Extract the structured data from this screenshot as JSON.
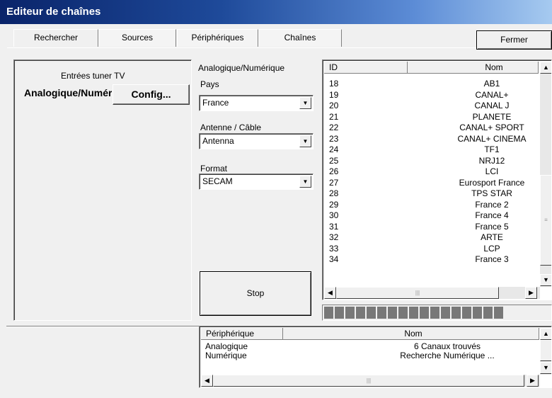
{
  "window": {
    "title": "Editeur de chaînes"
  },
  "tabs": [
    {
      "label": "Rechercher"
    },
    {
      "label": "Sources"
    },
    {
      "label": "Périphériques"
    },
    {
      "label": "Chaînes"
    }
  ],
  "close_label": "Fermer",
  "tuner": {
    "title": "Entrées tuner TV",
    "label": "Analogique/Numérique",
    "config_label": "Config..."
  },
  "form": {
    "mode_label": "Analogique/Numérique",
    "country_label": "Pays",
    "country_value": "France",
    "antenna_label": "Antenne / Câble",
    "antenna_value": "Antenna",
    "format_label": "Format",
    "format_value": "SECAM",
    "stop_label": "Stop"
  },
  "channels": {
    "columns": [
      "ID",
      "Nom"
    ],
    "rows": [
      {
        "id": "18",
        "name": "AB1"
      },
      {
        "id": "19",
        "name": "CANAL+"
      },
      {
        "id": "20",
        "name": "CANAL J"
      },
      {
        "id": "21",
        "name": "PLANETE"
      },
      {
        "id": "22",
        "name": "CANAL+ SPORT"
      },
      {
        "id": "23",
        "name": "CANAL+ CINEMA"
      },
      {
        "id": "24",
        "name": "TF1"
      },
      {
        "id": "25",
        "name": "NRJ12"
      },
      {
        "id": "26",
        "name": "LCI"
      },
      {
        "id": "27",
        "name": "Eurosport France"
      },
      {
        "id": "28",
        "name": "TPS STAR"
      },
      {
        "id": "29",
        "name": "France 2"
      },
      {
        "id": "30",
        "name": "France 4"
      },
      {
        "id": "31",
        "name": "France 5"
      },
      {
        "id": "32",
        "name": "ARTE"
      },
      {
        "id": "33",
        "name": "LCP"
      },
      {
        "id": "34",
        "name": "France 3"
      }
    ]
  },
  "progress": {
    "segments_filled": 17
  },
  "devices": {
    "columns": [
      "Périphérique",
      "Nom"
    ],
    "rows": [
      {
        "device": "Analogique",
        "name": "6 Canaux trouvés"
      },
      {
        "device": "Numérique",
        "name": "Recherche Numérique ..."
      }
    ]
  },
  "icons": {
    "scroll_up": "scroll-up-icon",
    "scroll_down": "scroll-down-icon",
    "scroll_left": "scroll-left-icon",
    "scroll_right": "scroll-right-icon",
    "dropdown": "chevron-down-icon"
  }
}
